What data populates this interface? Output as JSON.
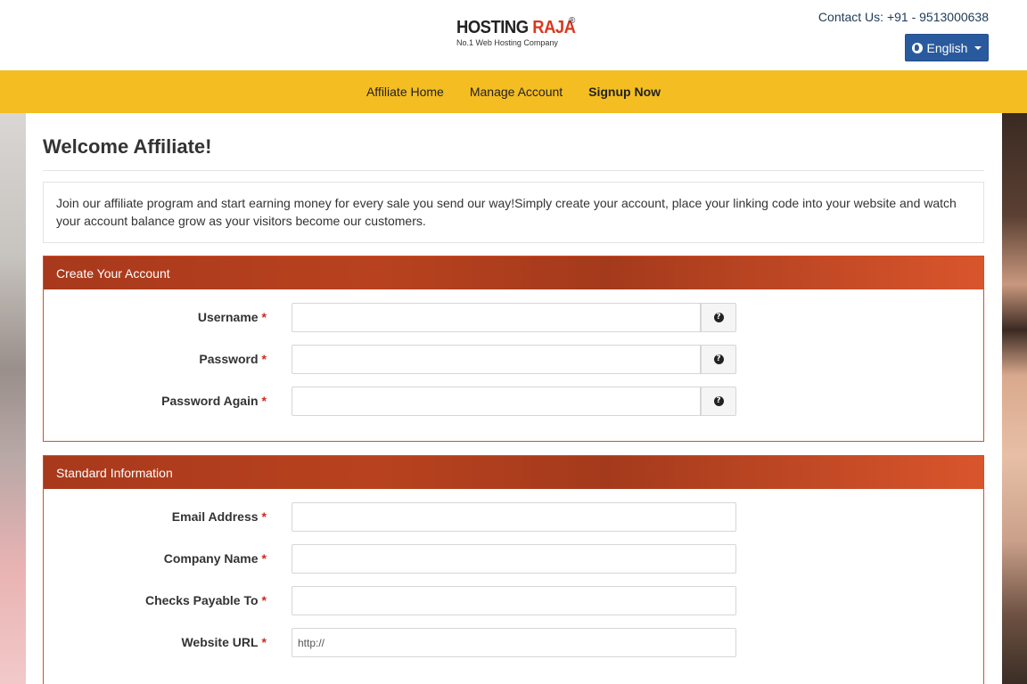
{
  "header": {
    "logo": {
      "brand_a": "HOSTING ",
      "brand_b": "RAJA",
      "registered": "®",
      "tagline": "No.1 Web Hosting Company"
    },
    "contact": "Contact Us: +91 - 9513000638",
    "language_button": "English"
  },
  "nav": {
    "items": [
      "Affiliate Home",
      "Manage Account",
      "Signup Now"
    ],
    "active": "Signup Now"
  },
  "page": {
    "title": "Welcome Affiliate!",
    "intro": "Join our affiliate program and start earning money for every sale you send our way!Simply create your account, place your linking code into your website and watch your account balance grow as your visitors become our customers."
  },
  "account_panel": {
    "title": "Create Your Account",
    "fields": [
      {
        "label": "Username",
        "required": "*",
        "value": "",
        "help": "?"
      },
      {
        "label": "Password",
        "required": "*",
        "value": "",
        "help": "?"
      },
      {
        "label": "Password Again",
        "required": "*",
        "value": "",
        "help": "?"
      }
    ]
  },
  "info_panel": {
    "title": "Standard Information",
    "fields": [
      {
        "label": "Email Address",
        "required": "*",
        "value": ""
      },
      {
        "label": "Company Name",
        "required": "*",
        "value": ""
      },
      {
        "label": "Checks Payable To",
        "required": "*",
        "value": ""
      },
      {
        "label": "Website URL",
        "required": "*",
        "value": "http://"
      }
    ]
  },
  "colors": {
    "navbar": "#f4bd22",
    "panel_header": "#b8421f",
    "language_button": "#2a5a9e",
    "required_marker": "#d0281c"
  }
}
